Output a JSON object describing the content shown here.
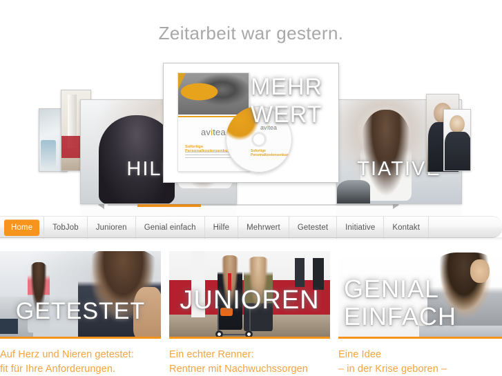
{
  "page": {
    "headline": "Zeitarbeit war gestern."
  },
  "carousel": {
    "prev_icon": "triangle-left-icon",
    "next_icon": "triangle-right-icon",
    "slides": [
      {
        "caption": "HILFE"
      },
      {
        "caption_line1": "MEHR",
        "caption_line2": "WERT"
      },
      {
        "caption": "TIATIVE"
      }
    ],
    "brochure": {
      "logo": "av",
      "logo_accent": "i",
      "logo_tail": "tea",
      "subtitle": "Sofortige Personalkostensenkung"
    },
    "cd": {
      "logo": "av",
      "logo_accent": "i",
      "logo_tail": "tea",
      "subtitle": "Sofortige Personalkostensenkung"
    }
  },
  "nav": {
    "items": [
      {
        "label": "Home",
        "active": true
      },
      {
        "label": "TobJob",
        "active": false
      },
      {
        "label": "Junioren",
        "active": false
      },
      {
        "label": "Genial einfach",
        "active": false
      },
      {
        "label": "Hilfe",
        "active": false
      },
      {
        "label": "Mehrwert",
        "active": false
      },
      {
        "label": "Getestet",
        "active": false
      },
      {
        "label": "Initiative",
        "active": false
      },
      {
        "label": "Kontakt",
        "active": false
      }
    ]
  },
  "panels": [
    {
      "overlay": "GETESTET",
      "line1": "Auf Herz und Nieren getestet:",
      "line2": "fit für Ihre Anforderungen."
    },
    {
      "overlay": "JUNIOREN",
      "line1": "Ein echter Renner:",
      "line2": "Rentner mit Nachwuchssorgen"
    },
    {
      "overlay_line1": "GENIAL",
      "overlay_line2": "EINFACH",
      "line1": "Eine Idee",
      "line2": "– in der Krise geboren –"
    }
  ],
  "colors": {
    "accent_orange": "#f7941d",
    "text_orange": "#f8a33c",
    "headline_gray": "#a8a8a8"
  }
}
